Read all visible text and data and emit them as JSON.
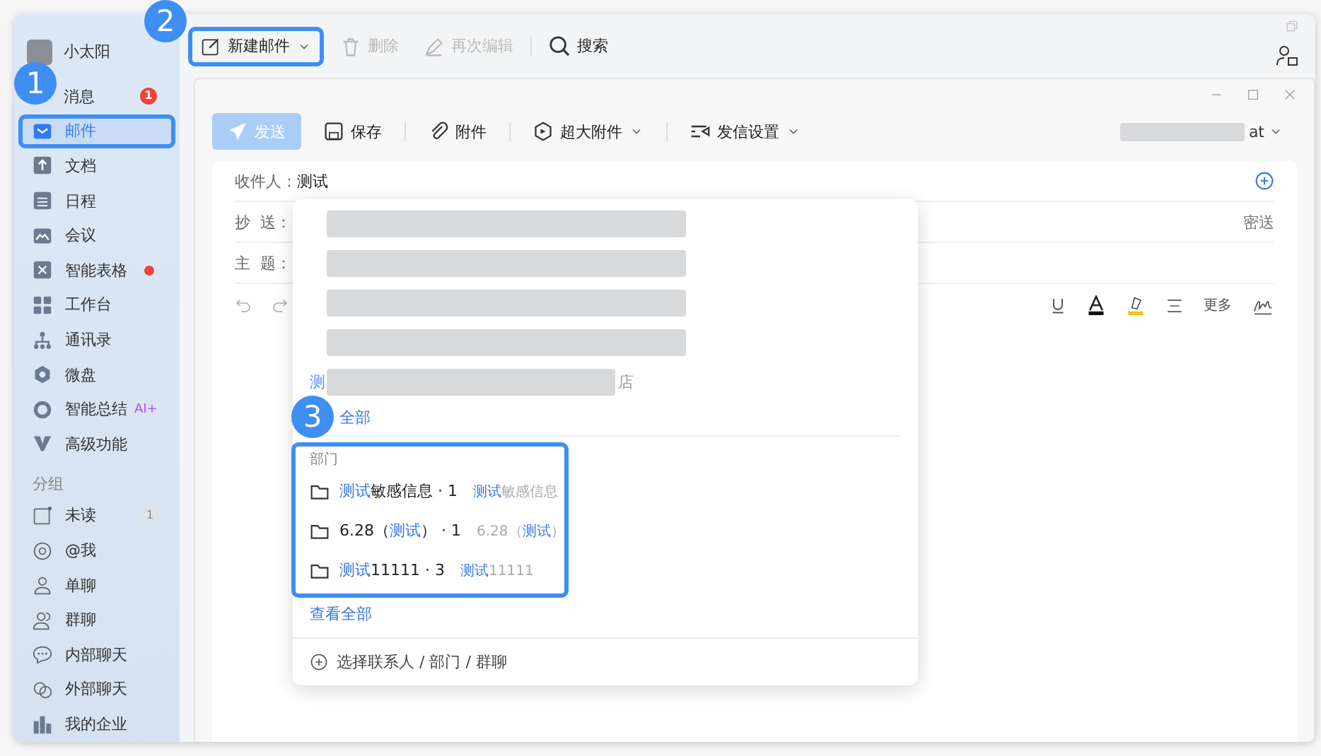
{
  "user": {
    "name": "小太阳"
  },
  "nav": [
    {
      "label": "消息",
      "selected": false,
      "badge": "1",
      "dot": false
    },
    {
      "label": "邮件",
      "selected": true,
      "dot": false
    },
    {
      "label": "文档",
      "selected": false,
      "dot": false
    },
    {
      "label": "日程",
      "selected": false,
      "dot": false
    },
    {
      "label": "会议",
      "selected": false,
      "dot": false
    },
    {
      "label": "智能表格",
      "selected": false,
      "dot": true
    },
    {
      "label": "工作台",
      "selected": false,
      "dot": false
    },
    {
      "label": "通讯录",
      "selected": false,
      "dot": false
    },
    {
      "label": "微盘",
      "selected": false,
      "dot": false
    },
    {
      "label": "智能总结",
      "selected": false,
      "dot": false,
      "tag": "AI+"
    },
    {
      "label": "高级功能",
      "selected": false,
      "dot": false
    }
  ],
  "group_title": "分组",
  "groups": [
    {
      "label": "未读",
      "count": "1"
    },
    {
      "label": "@我"
    },
    {
      "label": "单聊"
    },
    {
      "label": "群聊"
    },
    {
      "label": "内部聊天"
    },
    {
      "label": "外部聊天"
    },
    {
      "label": "我的企业"
    }
  ],
  "toolbar": [
    {
      "label": "新建邮件",
      "disabled": false,
      "dropdown": true
    },
    {
      "label": "删除",
      "disabled": true,
      "dropdown": false
    },
    {
      "label": "再次编辑",
      "disabled": true,
      "dropdown": false
    },
    {
      "label": "搜索",
      "disabled": false,
      "dropdown": false
    }
  ],
  "compose": {
    "actions": [
      {
        "label": "发送",
        "kind": "primary",
        "dropdown": false
      },
      {
        "label": "保存",
        "kind": "plain",
        "dropdown": false
      },
      {
        "label": "附件",
        "kind": "plain",
        "dropdown": false
      },
      {
        "label": "超大附件",
        "kind": "plain",
        "dropdown": true
      },
      {
        "label": "发信设置",
        "kind": "plain",
        "dropdown": true
      }
    ],
    "sender": {
      "suffix": "at"
    },
    "fields": [
      {
        "label": "收件人：",
        "value": "测试"
      },
      {
        "label": "抄  送：",
        "extra": "密送"
      },
      {
        "label": "主  题："
      }
    ],
    "format_tools": [
      {
        "label": "更多"
      }
    ]
  },
  "suggestions": {
    "contacts": [
      {
        "kind": "redacted"
      },
      {
        "kind": "redacted"
      },
      {
        "kind": "redacted"
      },
      {
        "kind": "redacted"
      },
      {
        "kind": "redacted",
        "prefix": "测",
        "suffix": "店"
      }
    ],
    "contacts_more": "全部",
    "section_title": "部门",
    "departments": [
      {
        "name": [
          {
            "text": "测试",
            "match": true
          },
          {
            "text": "敏感信息",
            "match": false
          }
        ],
        "count": " · 1",
        "path": [
          {
            "text": "测试",
            "match": true
          },
          {
            "text": "敏感信息",
            "match": false
          }
        ]
      },
      {
        "name": [
          {
            "text": "6.28（",
            "match": false
          },
          {
            "text": "测试",
            "match": true
          },
          {
            "text": "）",
            "match": false
          }
        ],
        "count": " · 1",
        "path": [
          {
            "text": "6.28（",
            "match": false
          },
          {
            "text": "测试",
            "match": true
          },
          {
            "text": "）",
            "match": false
          }
        ]
      },
      {
        "name": [
          {
            "text": "测试",
            "match": true
          },
          {
            "text": "11111",
            "match": false
          }
        ],
        "count": " · 3",
        "path": [
          {
            "text": "测试",
            "match": true
          },
          {
            "text": "11111",
            "match": false
          }
        ]
      }
    ],
    "departments_more": "查看全部",
    "footer": "选择联系人 / 部门 / 群聊"
  },
  "callouts": [
    {
      "number": "1"
    },
    {
      "number": "2"
    },
    {
      "number": "3"
    }
  ]
}
